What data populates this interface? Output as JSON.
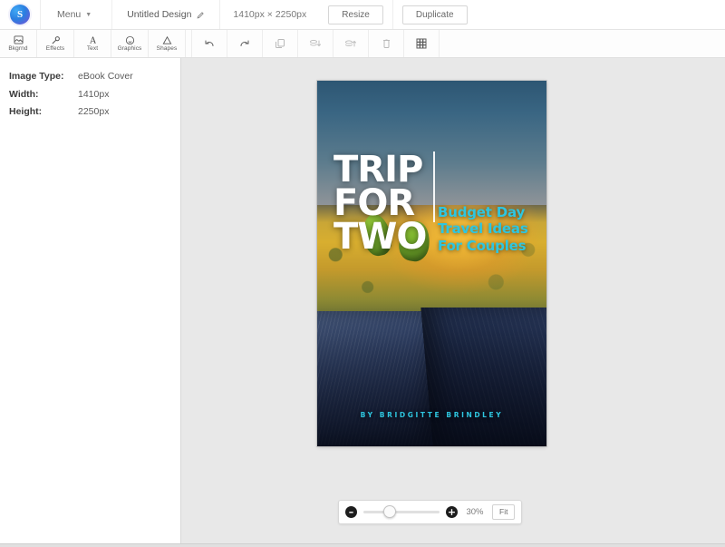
{
  "header": {
    "logo_text": "S",
    "menu_label": "Menu",
    "design_title": "Untitled Design",
    "dimensions_label": "1410px × 2250px",
    "resize_label": "Resize",
    "duplicate_label": "Duplicate"
  },
  "toolbar": {
    "tabs": [
      {
        "label": "Bkgrnd",
        "icon": "image-icon"
      },
      {
        "label": "Effects",
        "icon": "magic-wand-icon"
      },
      {
        "label": "Text",
        "icon": "text-a-icon"
      },
      {
        "label": "Graphics",
        "icon": "smiley-icon"
      },
      {
        "label": "Shapes",
        "icon": "triangle-icon"
      }
    ],
    "actions": [
      {
        "name": "undo",
        "icon": "undo-arrow-icon"
      },
      {
        "name": "redo",
        "icon": "redo-arrow-icon"
      },
      {
        "name": "duplicate-layer",
        "icon": "copy-icon"
      },
      {
        "name": "send-backward",
        "icon": "layers-down-icon"
      },
      {
        "name": "bring-forward",
        "icon": "layers-up-icon"
      },
      {
        "name": "delete",
        "icon": "trash-icon"
      },
      {
        "name": "grid",
        "icon": "grid-icon"
      }
    ]
  },
  "sidebar": {
    "info": [
      {
        "key": "Image Type:",
        "value": "eBook Cover"
      },
      {
        "key": "Width:",
        "value": "1410px"
      },
      {
        "key": "Height:",
        "value": "2250px"
      }
    ]
  },
  "cover": {
    "title_line1": "TRIP",
    "title_line2": "FOR",
    "title_line3": "TWO",
    "subtitle": "Budget Day Travel Ideas For Couples",
    "author": "BY BRIDGITTE BRINDLEY",
    "accent_color": "#2ec6e0",
    "title_color": "#ffffff"
  },
  "zoom": {
    "minus_label": "–",
    "plus_label": "+",
    "level_label": "30%",
    "fit_label": "Fit",
    "slider_value": 30
  }
}
